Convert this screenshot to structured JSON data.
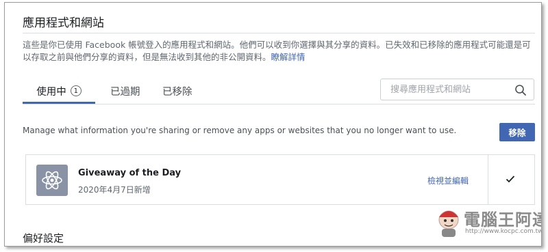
{
  "header": {
    "title": "應用程式和網站",
    "description": "這些是你已使用 Facebook 帳號登入的應用程式和網站。他們可以收到你選擇與其分享的資料。已失效和已移除的應用程式可能還是可以存取之前與他們分享的資料，但是無法收到其他的非公開資料。",
    "learn_more": "瞭解詳情"
  },
  "tabs": [
    {
      "label": "使用中",
      "count": "1",
      "active": true
    },
    {
      "label": "已過期"
    },
    {
      "label": "已移除"
    }
  ],
  "search": {
    "placeholder": "搜尋應用程式和網站",
    "icon": "search-icon"
  },
  "manage_text": "Manage what information you're sharing or remove any apps or websites that you no longer want to use.",
  "remove_button": "移除",
  "apps": [
    {
      "name": "Giveaway of the Day",
      "date": "2020年4月7日新增",
      "edit_label": "檢視並編輯",
      "checked": true,
      "icon": "atom-icon"
    }
  ],
  "preferences_title": "偏好設定",
  "watermark": {
    "text": "電腦王阿達",
    "url": "http://www.kocpc.com.tw"
  },
  "colors": {
    "accent": "#4267b2",
    "text": "#1c1e21",
    "muted": "#606770",
    "border": "#dadde1"
  }
}
